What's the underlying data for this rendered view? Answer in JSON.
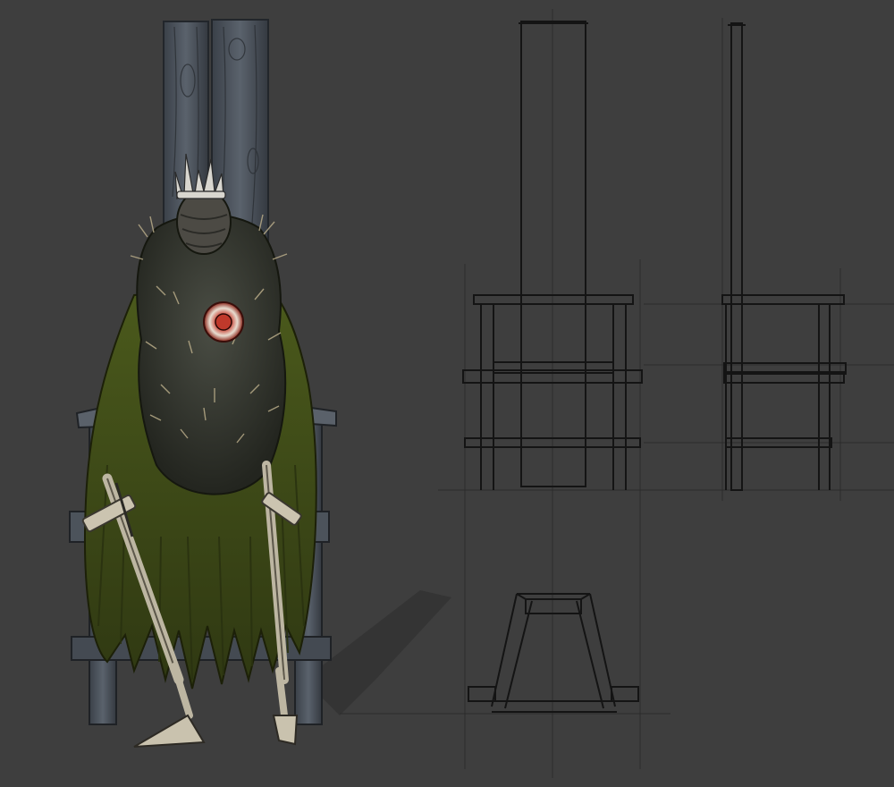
{
  "colors": {
    "background": "#3e3e3e",
    "wood": "#4a5058",
    "wood_dark": "#2c3036",
    "fur": "#3b3e35",
    "cloak": "#5a6a22",
    "cloak_dark": "#3b4418",
    "bone": "#c9c2ae",
    "heart_red": "#b0271f",
    "crown": "#d8d6cf",
    "line": "#151515",
    "construction_line": "#2e2e2e"
  }
}
